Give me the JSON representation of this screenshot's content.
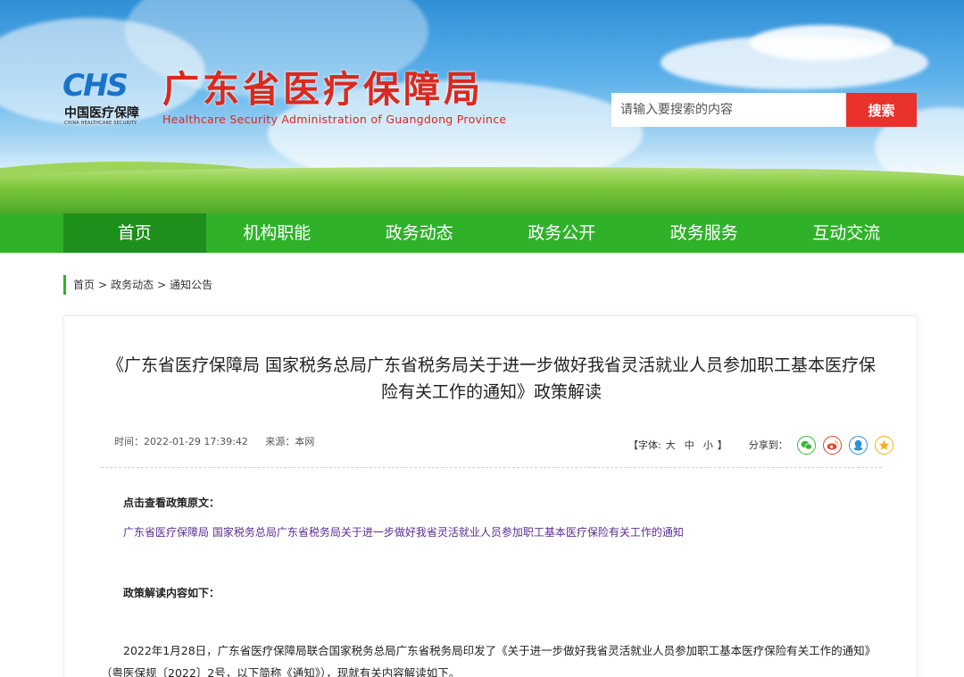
{
  "header": {
    "logo_mark": "CHS",
    "logo_cn": "中国医疗保障",
    "logo_en": "CHINA HEALTHCARE SECURITY",
    "site_title": "广东省医疗保障局",
    "site_subtitle": "Healthcare Security Administration of Guangdong Province",
    "search_placeholder": "请输入要搜索的内容",
    "search_button": "搜索"
  },
  "nav": {
    "items": [
      {
        "label": "首页",
        "active": true
      },
      {
        "label": "机构职能"
      },
      {
        "label": "政务动态"
      },
      {
        "label": "政务公开"
      },
      {
        "label": "政务服务"
      },
      {
        "label": "互动交流"
      }
    ]
  },
  "breadcrumb": {
    "items": [
      "首页",
      "政务动态",
      "通知公告"
    ],
    "separator": ">"
  },
  "article": {
    "title": "《广东省医疗保障局 国家税务总局广东省税务局关于进一步做好我省灵活就业人员参加职工基本医疗保险有关工作的通知》政策解读",
    "time": "时间：2022-01-29 17:39:42",
    "source": "来源：本网",
    "font_size_label": "【字体:",
    "font_size_options": [
      "大",
      "中",
      "小"
    ],
    "font_size_close": "】",
    "share_label": "分享到：",
    "share_icons": [
      "wechat-icon",
      "weibo-icon",
      "qq-icon",
      "qzone-icon"
    ],
    "share_colors": {
      "wechat": "#3fb33a",
      "weibo": "#e8432c",
      "qq": "#2f8fd6",
      "qzone": "#f3b21a"
    },
    "view_original_label": "点击查看政策原文：",
    "policy_link": "广东省医疗保障局 国家税务总局广东省税务局关于进一步做好我省灵活就业人员参加职工基本医疗保险有关工作的通知",
    "interpretation_label": "政策解读内容如下：",
    "body_paragraph": "2022年1月28日，广东省医疗保障局联合国家税务总局广东省税务局印发了《关于进一步做好我省灵活就业人员参加职工基本医疗保险有关工作的通知》（粤医保规〔2022〕2号，以下简称《通知》），现就有关内容解读如下。"
  },
  "colors": {
    "nav_green": "#2fb22a",
    "nav_active": "#1f8f1b",
    "title_red": "#d82a1e",
    "search_red": "#e8322b",
    "link_purple": "#5b2c91"
  }
}
